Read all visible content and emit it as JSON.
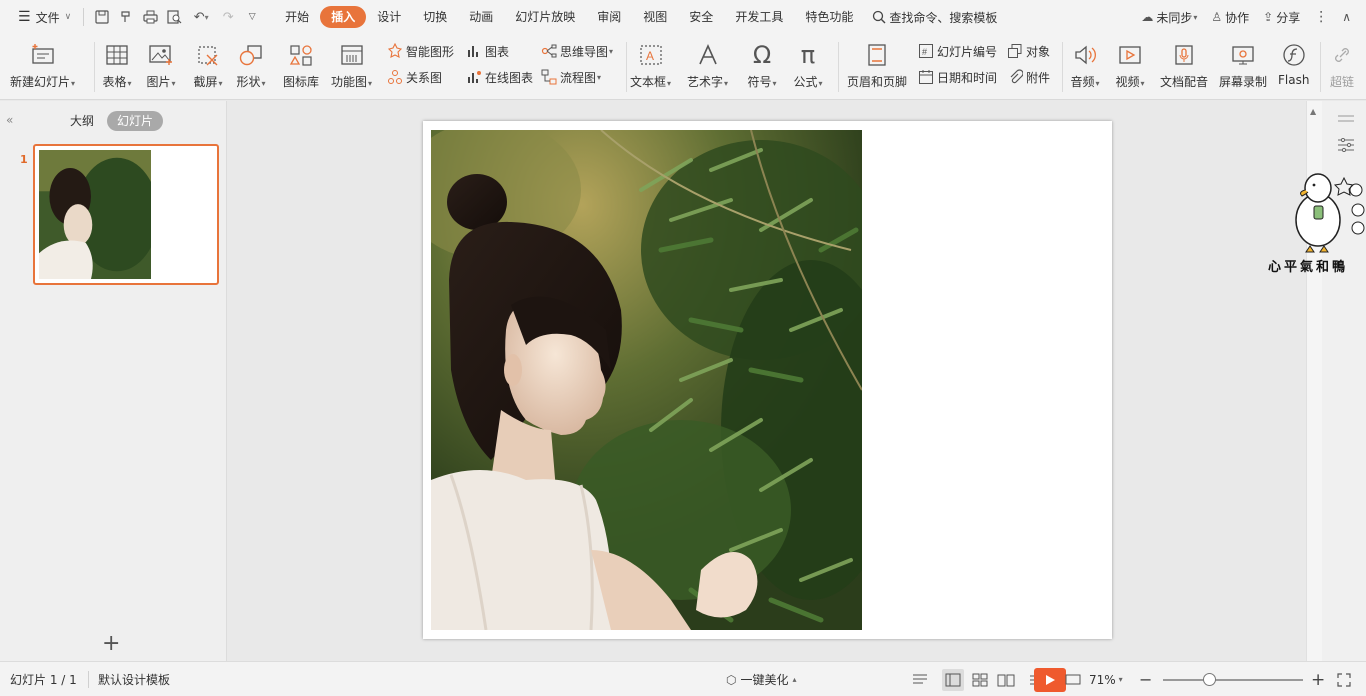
{
  "menubar": {
    "file_label": "文件",
    "tabs": [
      "开始",
      "插入",
      "设计",
      "切换",
      "动画",
      "幻灯片放映",
      "审阅",
      "视图",
      "安全",
      "开发工具",
      "特色功能"
    ],
    "active_tab": "插入",
    "search_label": "查找命令、搜索模板",
    "sync_label": "未同步",
    "collab_label": "协作",
    "share_label": "分享"
  },
  "ribbon": {
    "new_slide": "新建幻灯片",
    "table": "表格",
    "picture": "图片",
    "screenshot": "截屏",
    "shape": "形状",
    "icon_library": "图标库",
    "function_chart": "功能图",
    "smart_art": "智能图形",
    "chart": "图表",
    "relation_chart": "关系图",
    "online_chart": "在线图表",
    "mind_map": "思维导图",
    "flowchart": "流程图",
    "textbox": "文本框",
    "wordart": "艺术字",
    "symbol": "符号",
    "formula": "公式",
    "header_footer": "页眉和页脚",
    "slide_number": "幻灯片编号",
    "object": "对象",
    "date_time": "日期和时间",
    "attachment": "附件",
    "audio": "音频",
    "video": "视频",
    "doc_voiceover": "文档配音",
    "screen_record": "屏幕录制",
    "flash": "Flash",
    "hyperlink": "超链"
  },
  "leftpanel": {
    "outline_tab": "大纲",
    "slides_tab": "幻灯片",
    "slide_index": "1"
  },
  "watermark": {
    "text": "心平氣和鴨"
  },
  "statusbar": {
    "slide_counter": "幻灯片 1 / 1",
    "template": "默认设计模板",
    "beautify": "一键美化",
    "zoom": "71%"
  },
  "colors": {
    "accent": "#e8743b",
    "play_badge": "#ef5a2e"
  }
}
